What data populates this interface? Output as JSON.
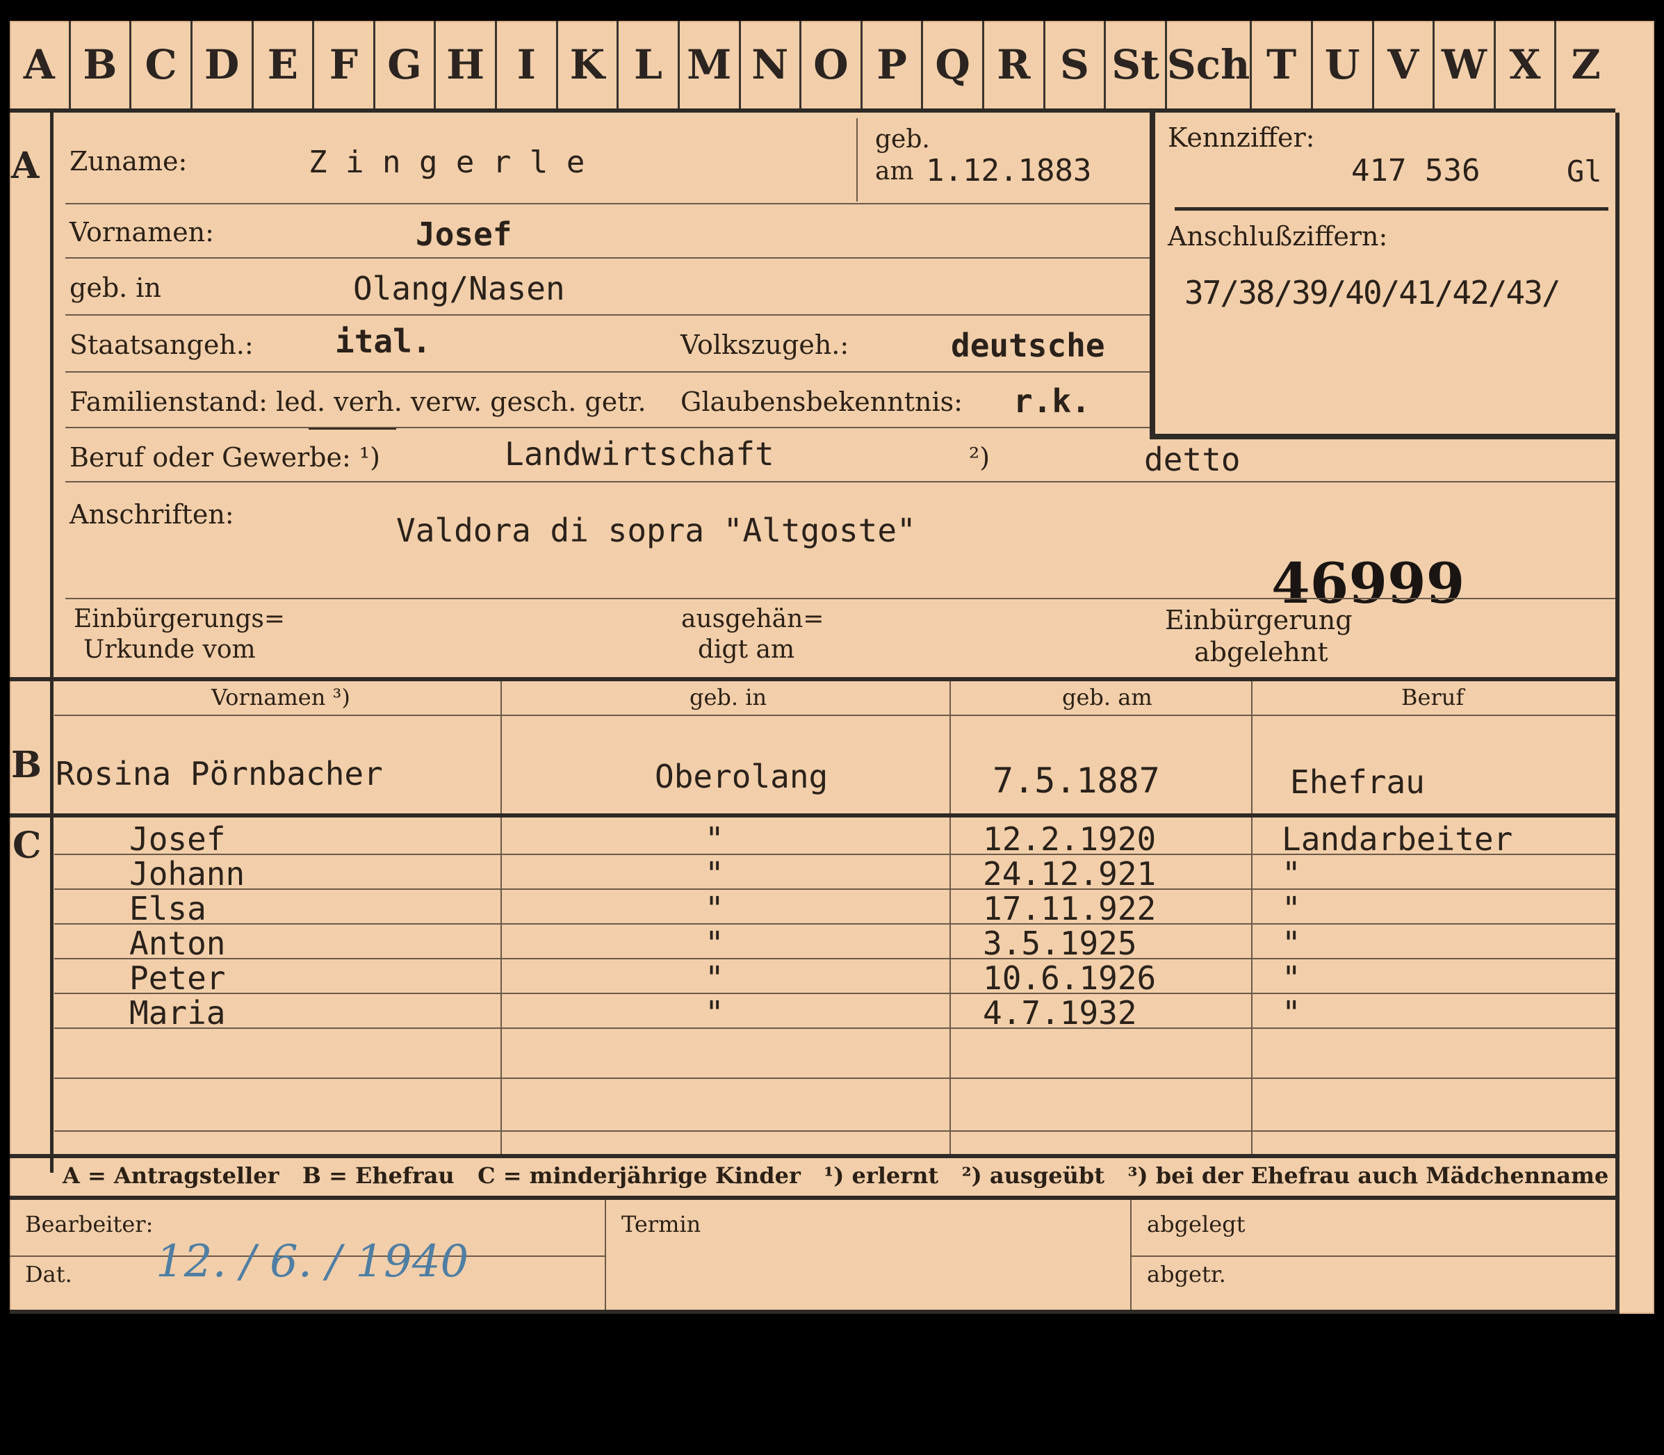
{
  "tabs": [
    "A",
    "B",
    "C",
    "D",
    "E",
    "F",
    "G",
    "H",
    "I",
    "K",
    "L",
    "M",
    "N",
    "O",
    "P",
    "Q",
    "R",
    "S",
    "St",
    "Sch",
    "T",
    "U",
    "V",
    "W",
    "X",
    "Z"
  ],
  "sections": {
    "a": "A",
    "b": "B",
    "c": "C"
  },
  "header": {
    "zuname_label": "Zuname:",
    "zuname_value": "Z i n g e r l e",
    "geb_label": "geb.",
    "am_label": "am",
    "geb_value": "1.12.1883",
    "kennziffer_label": "Kennziffer:",
    "kennziffer_value": "417 536",
    "kennziffer_suffix": "Gl",
    "vornamen_label": "Vornamen:",
    "vornamen_value": "Josef",
    "anschluss_label": "Anschlußziffern:",
    "anschluss_value": "37/38/39/40/41/42/43/",
    "gebin_label": "geb. in",
    "gebin_value": "Olang/Nasen",
    "staat_label": "Staatsangeh.:",
    "staat_value": "ital.",
    "volk_label": "Volkszugeh.:",
    "volk_value": "deutsche",
    "familienstand_label": "Familienstand: led. verh. verw. gesch. getr.",
    "glauben_label": "Glaubensbekenntnis:",
    "glauben_value": "r.k.",
    "beruf_label": "Beruf oder Gewerbe: ¹)",
    "beruf_value": "Landwirtschaft",
    "beruf2_label": "²)",
    "beruf2_value": "detto",
    "anschrift_label": "Anschriften:",
    "anschrift_value": "Valdora di sopra \"Altgoste\"",
    "stamp_number": "46999",
    "einb_label1": "Einbürgerungs=",
    "einb_label2": "Urkunde vom",
    "ausgeh_label1": "ausgehän=",
    "ausgeh_label2": "digt am",
    "abgelehnt_label1": "Einbürgerung",
    "abgelehnt_label2": "abgelehnt"
  },
  "table": {
    "headers": [
      "Vornamen ³)",
      "geb. in",
      "geb. am",
      "Beruf"
    ],
    "wife": {
      "name": "Rosina Pörnbacher",
      "place": "Oberolang",
      "date": "7.5.1887",
      "job": "Ehefrau"
    },
    "children": [
      {
        "name": "Josef",
        "place": "\"",
        "date": "12.2.1920",
        "job": "Landarbeiter"
      },
      {
        "name": "Johann",
        "place": "\"",
        "date": "24.12.921",
        "job": "\""
      },
      {
        "name": "Elsa",
        "place": "\"",
        "date": "17.11.922",
        "job": "\""
      },
      {
        "name": "Anton",
        "place": "\"",
        "date": "3.5.1925",
        "job": "\""
      },
      {
        "name": "Peter",
        "place": "\"",
        "date": "10.6.1926",
        "job": "\""
      },
      {
        "name": "Maria",
        "place": "\"",
        "date": "4.7.1932",
        "job": "\""
      }
    ]
  },
  "legend": "A = Antragsteller   B = Ehefrau   C = minderjährige Kinder   ¹) erlernt   ²) ausgeübt   ³) bei der Ehefrau auch Mädchenname",
  "footer": {
    "bearbeiter_label": "Bearbeiter:",
    "dat_label": "Dat.",
    "dat_value": "12. / 6. / 1940",
    "termin_label": "Termin",
    "abgelegt_label": "abgelegt",
    "abgetr_label": "abgetr."
  }
}
